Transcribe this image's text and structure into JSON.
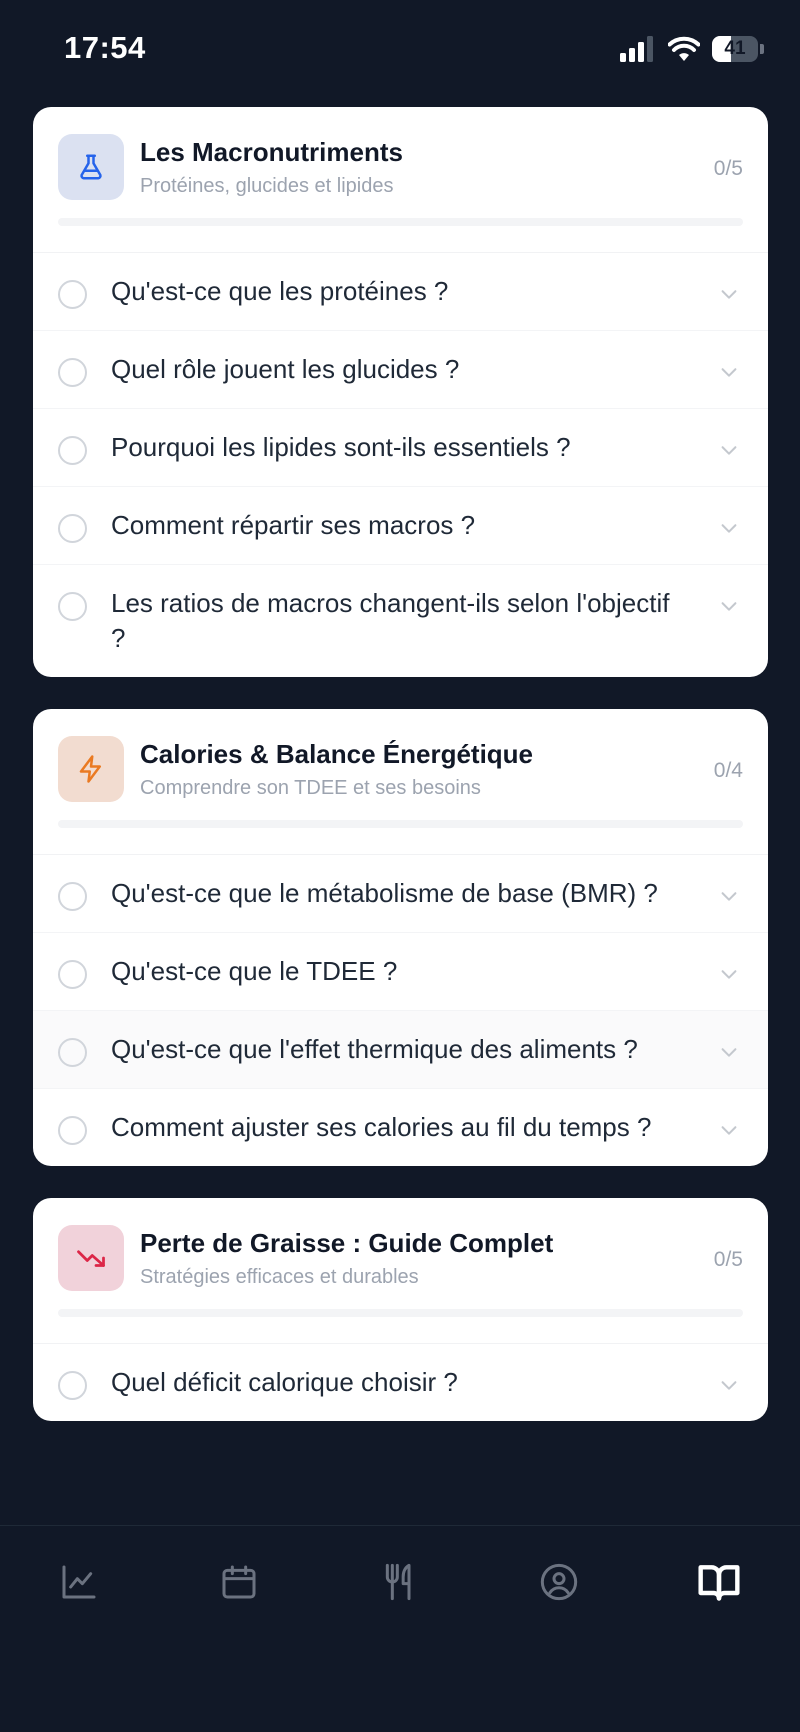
{
  "status_bar": {
    "time": "17:54",
    "battery_level": "41",
    "battery_fraction": 0.41,
    "signal_bars": 3,
    "wifi": true
  },
  "colors": {
    "background": "#111827",
    "card": "#ffffff",
    "text_primary": "#111827",
    "text_secondary": "#9ca3af",
    "question_text": "#1f2937",
    "active_tab": "#ffffff",
    "inactive_tab": "#6b7280"
  },
  "categories": [
    {
      "title": "Les Macronutriments",
      "subtitle": "Protéines, glucides et lipides",
      "count": "0/5",
      "progress": 0,
      "icon": "flask-icon",
      "icon_color": "#2563eb",
      "icon_bg": "#dbe1f1",
      "questions": [
        "Qu'est-ce que les protéines ?",
        "Quel rôle jouent les glucides ?",
        "Pourquoi les lipides sont-ils essentiels ?",
        "Comment répartir ses macros ?",
        "Les ratios de macros changent-ils selon l'objectif ?"
      ]
    },
    {
      "title": "Calories & Balance Énergétique",
      "subtitle": "Comprendre son TDEE et ses besoins",
      "count": "0/4",
      "progress": 0,
      "icon": "bolt-icon",
      "icon_color": "#ea7a22",
      "icon_bg": "#f2dcd0",
      "questions": [
        "Qu'est-ce que le métabolisme de base (BMR) ?",
        "Qu'est-ce que le TDEE ?",
        "Qu'est-ce que l'effet thermique des aliments ?",
        "Comment ajuster ses calories au fil du temps ?"
      ]
    },
    {
      "title": "Perte de Graisse : Guide Complet",
      "subtitle": "Stratégies efficaces et durables",
      "count": "0/5",
      "progress": 0,
      "icon": "trending-down-icon",
      "icon_color": "#dc2647",
      "icon_bg": "#f1d2da",
      "questions": [
        "Quel déficit calorique choisir ?"
      ]
    }
  ],
  "tabs": [
    {
      "name": "stats",
      "icon": "chart-line-icon",
      "active": false
    },
    {
      "name": "calendar",
      "icon": "calendar-icon",
      "active": false
    },
    {
      "name": "meals",
      "icon": "fork-knife-icon",
      "active": false
    },
    {
      "name": "profile",
      "icon": "user-circle-icon",
      "active": false
    },
    {
      "name": "guide",
      "icon": "book-open-icon",
      "active": true
    }
  ]
}
